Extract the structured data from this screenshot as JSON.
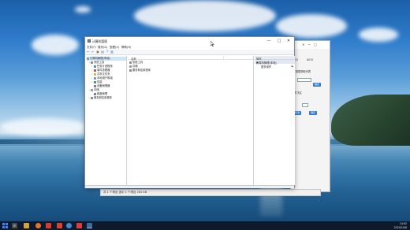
{
  "desktop": {
    "accent": "#1f5fa6"
  },
  "back_window": {
    "tabs": [
      "AIOO",
      "AIOO"
    ],
    "rows": [
      "数据获取列表",
      "确定",
      "暂不决定",
      "取消",
      "确定"
    ],
    "status_text": "共 1 个项目   选中 1 个项目  262 KB"
  },
  "main_window": {
    "title": "计算机管理",
    "controls": {
      "min": "—",
      "max": "□",
      "close": "✕"
    },
    "menu": [
      "文件(F)",
      "操作(A)",
      "查看(V)",
      "帮助(H)"
    ],
    "toolbar_icons": [
      "back-icon",
      "forward-icon",
      "up-icon",
      "properties-icon",
      "help-icon",
      "show-hide-icon"
    ],
    "tree": [
      {
        "label": "计算机管理(本地)",
        "level": 0,
        "expander": "",
        "selected": true
      },
      {
        "label": "系统工具",
        "level": 1,
        "expander": "⌄",
        "selected": false
      },
      {
        "label": "任务计划程序",
        "level": 2,
        "expander": "›",
        "selected": false
      },
      {
        "label": "事件查看器",
        "level": 2,
        "expander": "›",
        "selected": false
      },
      {
        "label": "共享文件夹",
        "level": 2,
        "expander": "›",
        "selected": false
      },
      {
        "label": "本地用户和组",
        "level": 2,
        "expander": "›",
        "selected": false
      },
      {
        "label": "性能",
        "level": 2,
        "expander": "›",
        "selected": false
      },
      {
        "label": "设备管理器",
        "level": 2,
        "expander": "",
        "selected": false
      },
      {
        "label": "存储",
        "level": 1,
        "expander": "⌄",
        "selected": false
      },
      {
        "label": "磁盘管理",
        "level": 2,
        "expander": "",
        "selected": false
      },
      {
        "label": "服务和应用程序",
        "level": 1,
        "expander": "›",
        "selected": false
      }
    ],
    "list_header": "名称",
    "list_items": [
      "系统工具",
      "存储",
      "服务和应用程序"
    ],
    "actions": {
      "header": "操作",
      "section": "计算机管理(本地)",
      "item": "更多操作"
    }
  },
  "taskbar": {
    "time": "14:02",
    "date": "2024/10/8"
  }
}
